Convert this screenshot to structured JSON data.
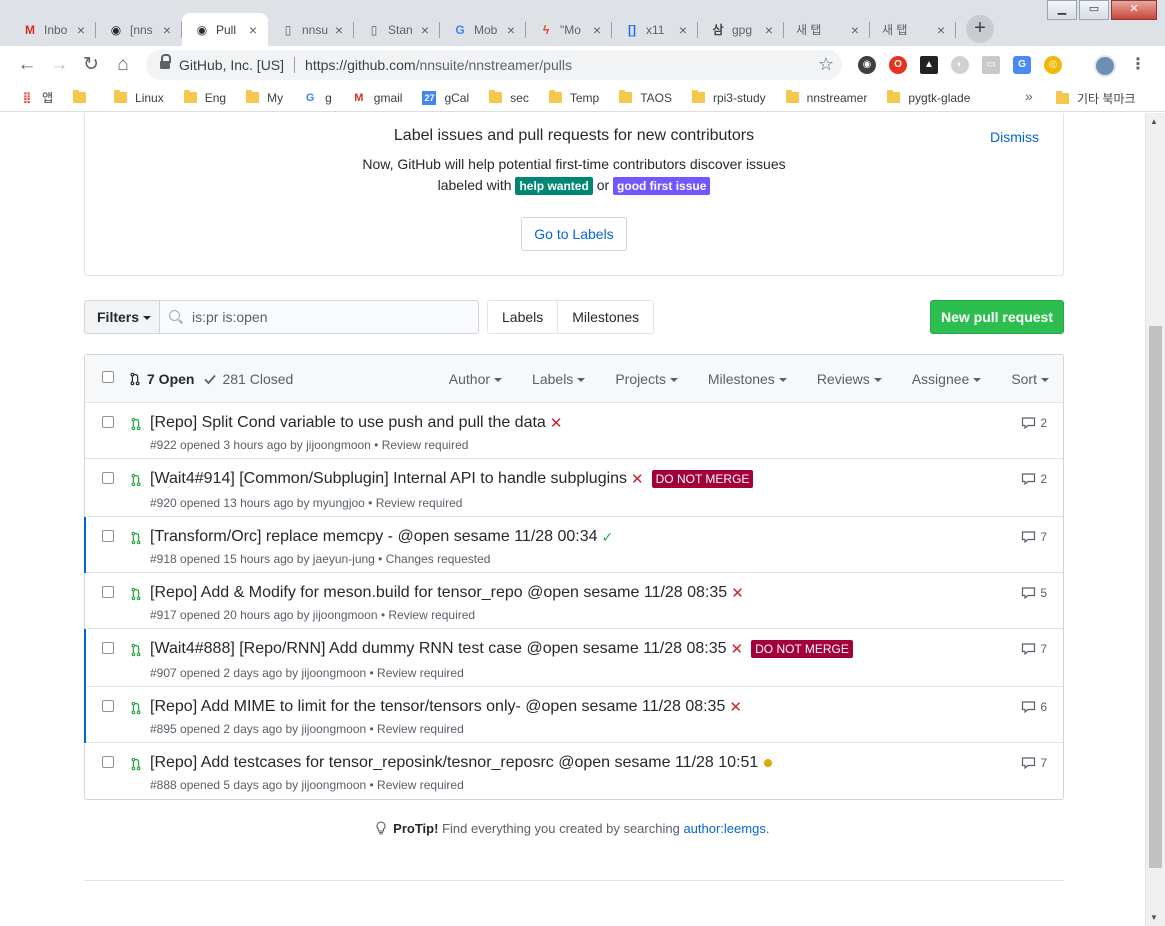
{
  "browser": {
    "tabs": [
      {
        "title": "Inbo",
        "icon": "gmail-icon",
        "active": false
      },
      {
        "title": "[nns",
        "icon": "github-icon",
        "active": false
      },
      {
        "title": "Pull",
        "icon": "github-icon",
        "active": true
      },
      {
        "title": "nnsu",
        "icon": "page-icon",
        "active": false
      },
      {
        "title": "Stan",
        "icon": "page-icon",
        "active": false
      },
      {
        "title": "Mob",
        "icon": "google-icon",
        "active": false
      },
      {
        "title": "\"Mo",
        "icon": "bitbucket-icon",
        "active": false
      },
      {
        "title": "x11",
        "icon": "brackets-icon",
        "active": false
      },
      {
        "title": "gpg",
        "icon": "samsung-icon",
        "active": false
      },
      {
        "title": "새 탭",
        "icon": "none",
        "active": false
      },
      {
        "title": "새 탭",
        "icon": "none",
        "active": false
      }
    ],
    "site_identity": "GitHub, Inc. [US]",
    "url_host": "https://github.com",
    "url_path": "/nnsuite/nnstreamer/pulls",
    "bookmarks": [
      {
        "label": "앱",
        "icon": "apps-grid-icon"
      },
      {
        "label": "",
        "icon": "folder-icon"
      },
      {
        "label": "Linux",
        "icon": "folder-icon"
      },
      {
        "label": "Eng",
        "icon": "folder-icon"
      },
      {
        "label": "My",
        "icon": "folder-icon"
      },
      {
        "label": "g",
        "icon": "google-icon"
      },
      {
        "label": "gmail",
        "icon": "gmail-icon"
      },
      {
        "label": "gCal",
        "icon": "calendar-icon"
      },
      {
        "label": "sec",
        "icon": "folder-icon"
      },
      {
        "label": "Temp",
        "icon": "folder-icon"
      },
      {
        "label": "TAOS",
        "icon": "folder-icon"
      },
      {
        "label": "rpi3-study",
        "icon": "folder-icon"
      },
      {
        "label": "nnstreamer",
        "icon": "folder-icon"
      },
      {
        "label": "pygtk-glade",
        "icon": "folder-icon"
      }
    ],
    "bookmarks_more": "»",
    "other_bookmarks": "기타 북마크",
    "calendar_day": "27"
  },
  "banner": {
    "title": "Label issues and pull requests for new contributors",
    "line1": "Now, GitHub will help potential first-time contributors discover issues",
    "line2_prefix": "labeled with",
    "label_help": "help wanted",
    "or": "or",
    "label_gfi": "good first issue",
    "dismiss": "Dismiss",
    "goto": "Go to Labels"
  },
  "subnav": {
    "filters": "Filters",
    "search_value": "is:pr is:open",
    "labels": "Labels",
    "milestones": "Milestones",
    "new_pr": "New pull request"
  },
  "table": {
    "open": "7 Open",
    "closed": "281 Closed",
    "filters": [
      "Author",
      "Labels",
      "Projects",
      "Milestones",
      "Reviews",
      "Assignee",
      "Sort"
    ]
  },
  "pulls": [
    {
      "title": "[Repo] Split Cond variable to use push and pull the data",
      "status": "fail",
      "label": "",
      "meta": "#922 opened 3 hours ago by jijoongmoon • Review required",
      "comments": "2",
      "accent": false
    },
    {
      "title": "[Wait4#914] [Common/Subplugin] Internal API to handle subplugins",
      "status": "fail",
      "label": "DO NOT MERGE",
      "meta": "#920 opened 13 hours ago by myungjoo • Review required",
      "comments": "2",
      "accent": false
    },
    {
      "title": "[Transform/Orc] replace memcpy - @open sesame 11/28 00:34",
      "status": "success",
      "label": "",
      "meta": "#918 opened 15 hours ago by jaeyun-jung • Changes requested",
      "comments": "7",
      "accent": true
    },
    {
      "title": "[Repo] Add & Modify for meson.build for tensor_repo @open sesame 11/28 08:35",
      "status": "fail",
      "label": "",
      "meta": "#917 opened 20 hours ago by jijoongmoon • Review required",
      "comments": "5",
      "accent": false
    },
    {
      "title": "[Wait4#888] [Repo/RNN] Add dummy RNN test case @open sesame 11/28 08:35",
      "status": "fail",
      "label": "DO NOT MERGE",
      "meta": "#907 opened 2 days ago by jijoongmoon • Review required",
      "comments": "7",
      "accent": true
    },
    {
      "title": "[Repo] Add MIME to limit for the tensor/tensors only- @open sesame 11/28 08:35",
      "status": "fail",
      "label": "",
      "meta": "#895 opened 2 days ago by jijoongmoon • Review required",
      "comments": "6",
      "accent": true
    },
    {
      "title": "[Repo] Add testcases for tensor_reposink/tesnor_reposrc @open sesame 11/28 10:51",
      "status": "pending",
      "label": "",
      "meta": "#888 opened 5 days ago by jijoongmoon • Review required",
      "comments": "7",
      "accent": false
    }
  ],
  "protip": {
    "lead": "ProTip!",
    "text": "Find everything you created by searching",
    "link": "author:leemgs",
    "end": "."
  },
  "colors": {
    "open_green": "#28a745",
    "fail_red": "#cb2431",
    "pending_yellow": "#dbab09",
    "dnm_label": "#a2003b",
    "help_wanted": "#008672",
    "good_first_issue": "#7057ff",
    "link_blue": "#0366d6"
  }
}
